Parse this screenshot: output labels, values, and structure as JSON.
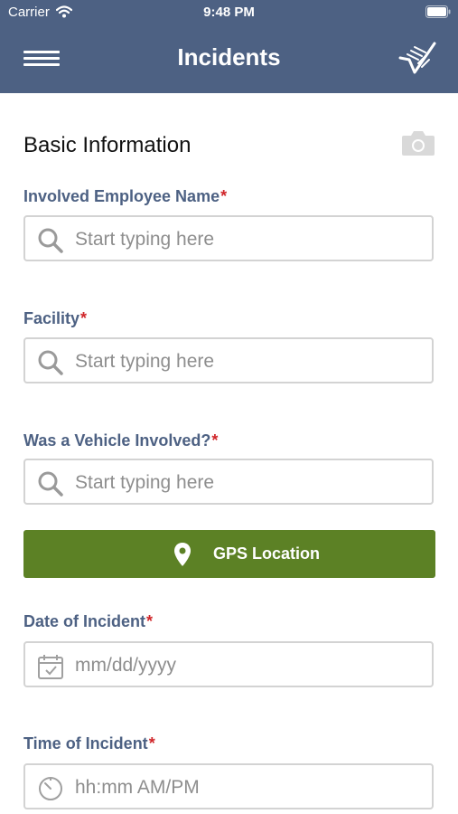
{
  "status_bar": {
    "carrier": "Carrier",
    "time": "9:48 PM"
  },
  "header": {
    "title": "Incidents"
  },
  "section": {
    "title": "Basic Information"
  },
  "fields": {
    "employee": {
      "label": "Involved Employee Name",
      "required": "*",
      "placeholder": "Start typing here"
    },
    "facility": {
      "label": "Facility",
      "required": "*",
      "placeholder": "Start typing here"
    },
    "vehicle": {
      "label": "Was a Vehicle Involved?",
      "required": "*",
      "placeholder": "Start typing here"
    },
    "date": {
      "label": "Date of Incident",
      "required": "*",
      "placeholder": "mm/dd/yyyy"
    },
    "time": {
      "label": "Time of Incident",
      "required": "*",
      "placeholder": "hh:mm AM/PM"
    }
  },
  "gps_button": {
    "label": "GPS Location"
  },
  "colors": {
    "header": "#4d6183",
    "label": "#4d6183",
    "required": "#d0262a",
    "gps": "#5c8125",
    "placeholder": "#8e8e8e"
  },
  "icons": [
    "wifi-icon",
    "battery-icon",
    "menu-icon",
    "logo-icon",
    "camera-icon",
    "search-icon",
    "location-pin-icon",
    "calendar-icon",
    "clock-icon"
  ]
}
